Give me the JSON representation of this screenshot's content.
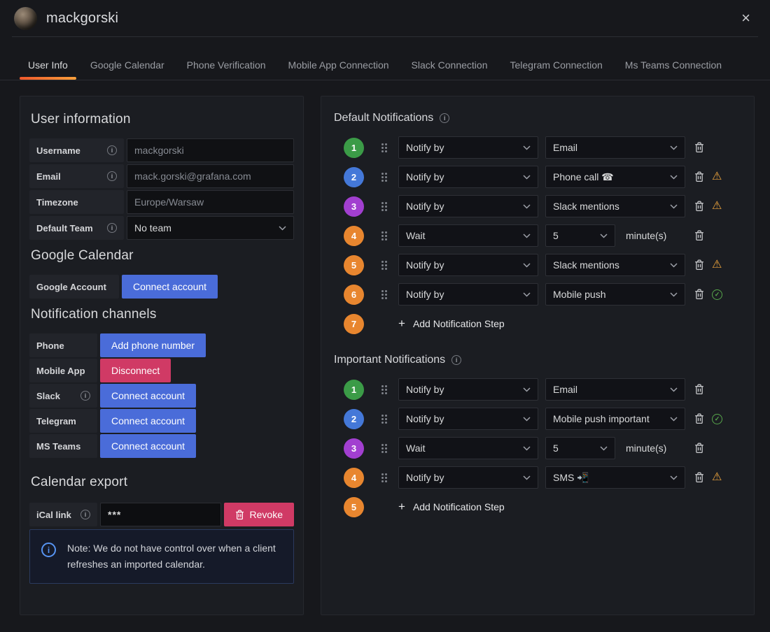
{
  "header": {
    "title": "mackgorski"
  },
  "icons": {
    "close": "×",
    "info": "i",
    "warning": "⚠",
    "check": "✓",
    "plus": "+"
  },
  "colors": {
    "accent_gradient_start": "#ef582b",
    "accent_gradient_end": "#f9a03c",
    "primary_button": "#4a6cd9",
    "destructive_button": "#d03a65",
    "warning": "#eba33c",
    "success": "#57a64b",
    "info_blue": "#5794f2"
  },
  "tabs": [
    {
      "label": "User Info"
    },
    {
      "label": "Google Calendar"
    },
    {
      "label": "Phone Verification"
    },
    {
      "label": "Mobile App Connection"
    },
    {
      "label": "Slack Connection"
    },
    {
      "label": "Telegram Connection"
    },
    {
      "label": "Ms Teams Connection"
    }
  ],
  "user_information": {
    "title": "User information",
    "fields": [
      {
        "label": "Username",
        "value": "mackgorski"
      },
      {
        "label": "Email",
        "value": "mack.gorski@grafana.com"
      },
      {
        "label": "Timezone",
        "value": "Europe/Warsaw"
      },
      {
        "label": "Default Team",
        "value": "No team"
      }
    ]
  },
  "google_calendar": {
    "title": "Google Calendar",
    "label": "Google Account",
    "button": "Connect account"
  },
  "notification_channels": {
    "title": "Notification channels",
    "rows": [
      {
        "label": "Phone",
        "button": "Add phone number"
      },
      {
        "label": "Mobile App",
        "button": "Disconnect"
      },
      {
        "label": "Slack",
        "button": "Connect account"
      },
      {
        "label": "Telegram",
        "button": "Connect account"
      },
      {
        "label": "MS Teams",
        "button": "Connect account"
      }
    ]
  },
  "calendar_export": {
    "title": "Calendar export",
    "label": "iCal link",
    "value": "***",
    "revoke_button": "Revoke",
    "note": "Note: We do not have control over when a client refreshes an imported calendar."
  },
  "default_notifications": {
    "title": "Default Notifications",
    "add_step": "Add Notification Step",
    "steps": [
      {
        "num": "1",
        "color": "#3b9b47",
        "action": "Notify by",
        "target": "Email"
      },
      {
        "num": "2",
        "color": "#4478d8",
        "action": "Notify by",
        "target": "Phone call ☎"
      },
      {
        "num": "3",
        "color": "#a23fd0",
        "action": "Notify by",
        "target": "Slack mentions"
      },
      {
        "num": "4",
        "color": "#e8862f",
        "action": "Wait",
        "value": "5",
        "unit": "minute(s)"
      },
      {
        "num": "5",
        "color": "#e8862f",
        "action": "Notify by",
        "target": "Slack mentions"
      },
      {
        "num": "6",
        "color": "#e8862f",
        "action": "Notify by",
        "target": "Mobile push"
      },
      {
        "num": "7",
        "color": "#e8862f"
      }
    ]
  },
  "important_notifications": {
    "title": "Important Notifications",
    "add_step": "Add Notification Step",
    "steps": [
      {
        "num": "1",
        "color": "#3b9b47",
        "action": "Notify by",
        "target": "Email"
      },
      {
        "num": "2",
        "color": "#4478d8",
        "action": "Notify by",
        "target": "Mobile push important"
      },
      {
        "num": "3",
        "color": "#a23fd0",
        "action": "Wait",
        "value": "5",
        "unit": "minute(s)"
      },
      {
        "num": "4",
        "color": "#e8862f",
        "action": "Notify by",
        "target": "SMS 📲"
      },
      {
        "num": "5",
        "color": "#e8862f"
      }
    ]
  }
}
